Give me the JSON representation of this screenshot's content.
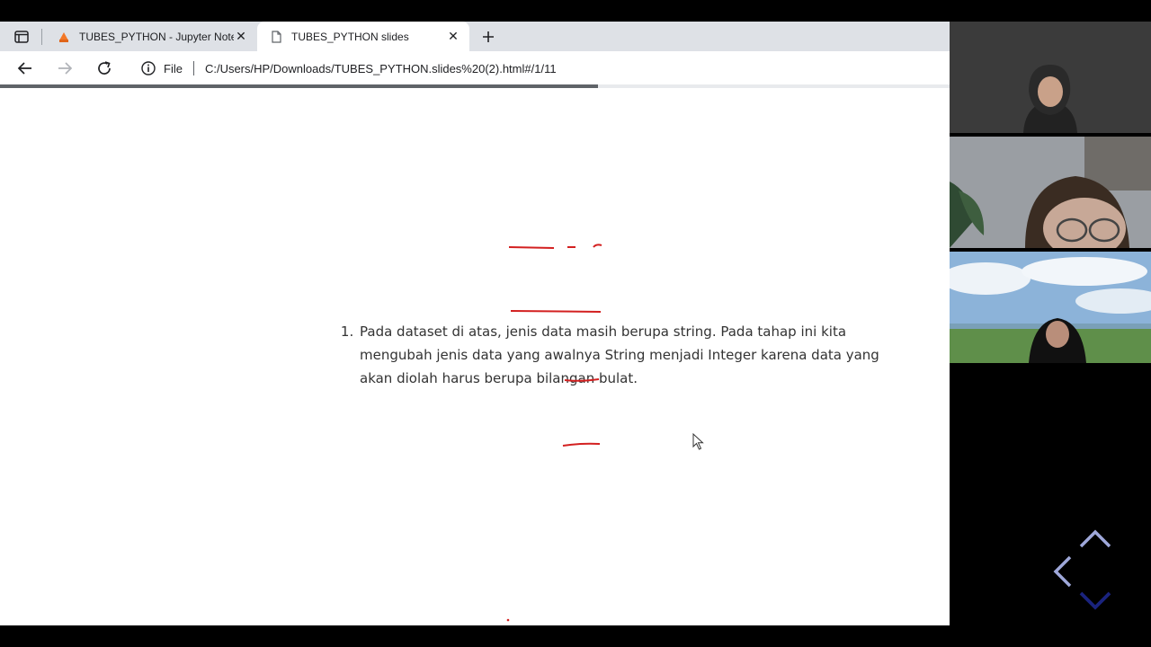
{
  "browser": {
    "tabs": [
      {
        "title": "TUBES_PYTHON - Jupyter Notebook",
        "active": false,
        "icon": "jupyter-icon"
      },
      {
        "title": "TUBES_PYTHON slides",
        "active": true,
        "icon": "page-icon"
      }
    ],
    "address": {
      "scheme_label": "File",
      "url": "C:/Users/HP/Downloads/TUBES_PYTHON.slides%20(2).html#/1/11"
    },
    "load_progress": 0.63,
    "colors": {
      "tabstrip": "#dee1e6",
      "accent_jupyter": "#f37726"
    }
  },
  "slide": {
    "list_items": [
      "Pada dataset di atas, jenis data masih berupa string. Pada tahap ini kita mengubah jenis data yang awalnya String menjadi Integer karena data yang akan diolah harus berupa bilangan bulat."
    ],
    "ink_color": "#d32020",
    "nav_color_active": "#1a237e",
    "nav_color_inactive": "#9fa8da"
  },
  "video_call": {
    "participants": [
      {
        "id": "participant-1"
      },
      {
        "id": "participant-2"
      },
      {
        "id": "participant-3"
      }
    ]
  }
}
